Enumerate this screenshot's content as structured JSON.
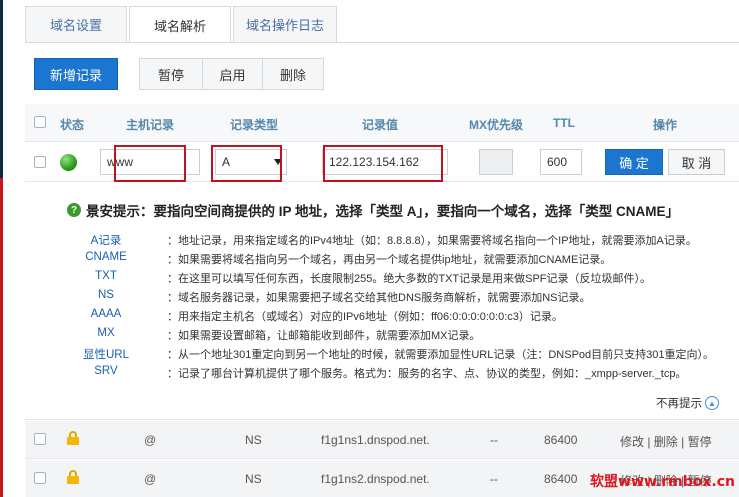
{
  "tabs": [
    {
      "label": "域名设置",
      "active": false
    },
    {
      "label": "域名解析",
      "active": true
    },
    {
      "label": "域名操作日志",
      "active": false
    }
  ],
  "toolbar": {
    "add_label": "新增记录",
    "pause_label": "暂停",
    "enable_label": "启用",
    "delete_label": "删除"
  },
  "table": {
    "headers": {
      "status": "状态",
      "host": "主机记录",
      "type": "记录类型",
      "value": "记录值",
      "mx": "MX优先级",
      "ttl": "TTL",
      "actions": "操作"
    }
  },
  "edit": {
    "host": "www",
    "type": "A",
    "value": "122.123.154.162",
    "mx": "",
    "ttl": "600",
    "ok_label": "确 定",
    "cancel_label": "取 消"
  },
  "tips": {
    "title": "景安提示：要指向空间商提供的 IP 地址，选择「类型 A」，要指向一个域名，选择「类型 CNAME」",
    "items": [
      {
        "type": "A记录",
        "desc": "：地址记录，用来指定域名的IPv4地址（如：8.8.8.8），如果需要将域名指向一个IP地址，就需要添加A记录。"
      },
      {
        "type": "CNAME",
        "desc": "：如果需要将域名指向另一个域名，再由另一个域名提供ip地址，就需要添加CNAME记录。"
      },
      {
        "type": "TXT",
        "desc": "：在这里可以填写任何东西，长度限制255。绝大多数的TXT记录是用来做SPF记录（反垃圾邮件）。"
      },
      {
        "type": "NS",
        "desc": "：域名服务器记录，如果需要把子域名交给其他DNS服务商解析，就需要添加NS记录。"
      },
      {
        "type": "AAAA",
        "desc": "：用来指定主机名（或域名）对应的IPv6地址（例如：ff06:0:0:0:0:0:0:c3）记录。"
      },
      {
        "type": "MX",
        "desc": "：如果需要设置邮箱，让邮箱能收到邮件，就需要添加MX记录。"
      },
      {
        "type": "显性URL",
        "desc": "：从一个地址301重定向到另一个地址的时候，就需要添加显性URL记录（注：DNSPod目前只支持301重定向）。"
      },
      {
        "type": "SRV",
        "desc": "：记录了哪台计算机提供了哪个服务。格式为：服务的名字、点、协议的类型，例如：_xmpp-server._tcp。"
      }
    ],
    "hide_label": "不再提示"
  },
  "records": [
    {
      "host": "@",
      "type": "NS",
      "value": "f1g1ns1.dnspod.net.",
      "mx": "--",
      "ttl": "86400",
      "actions": "修改 | 删除 | 暂停"
    },
    {
      "host": "@",
      "type": "NS",
      "value": "f1g1ns2.dnspod.net.",
      "mx": "--",
      "ttl": "86400",
      "actions": "修改 | 删除 | 暂停"
    }
  ],
  "watermark": "软盟www.rmbox.cn",
  "colors": {
    "primary": "#1b75d1",
    "highlight_border": "#c0141c",
    "status_ok": "#2e9b1d",
    "link": "#1b5fb3"
  }
}
